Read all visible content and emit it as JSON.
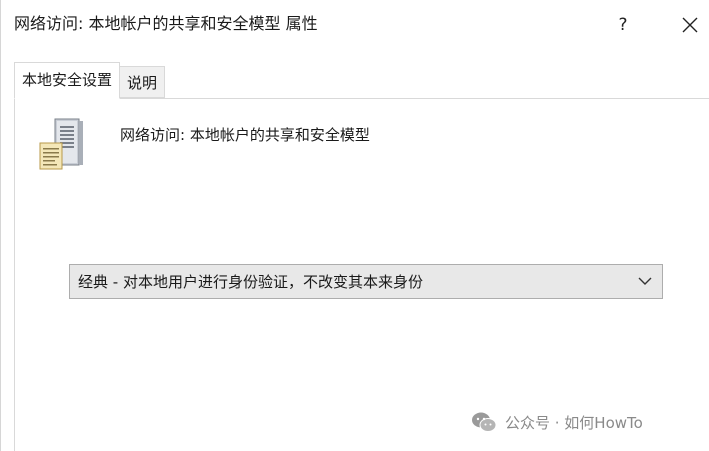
{
  "window": {
    "title": "网络访问: 本地帐户的共享和安全模型 属性",
    "help_label": "?"
  },
  "tabs": [
    {
      "label": "本地安全设置",
      "active": true
    },
    {
      "label": "说明",
      "active": false
    }
  ],
  "policy": {
    "icon": "server-policy-icon",
    "name": "网络访问: 本地帐户的共享和安全模型"
  },
  "dropdown": {
    "selected": "经典 - 对本地用户进行身份验证，不改变其本来身份"
  },
  "watermark": {
    "text": "公众号 · 如何HowTo"
  },
  "colors": {
    "tab_inactive": "#f0f0f0",
    "dropdown_bg": "#e8e8e8",
    "border": "#d9d9d9",
    "watermark": "#8a8a8a"
  }
}
